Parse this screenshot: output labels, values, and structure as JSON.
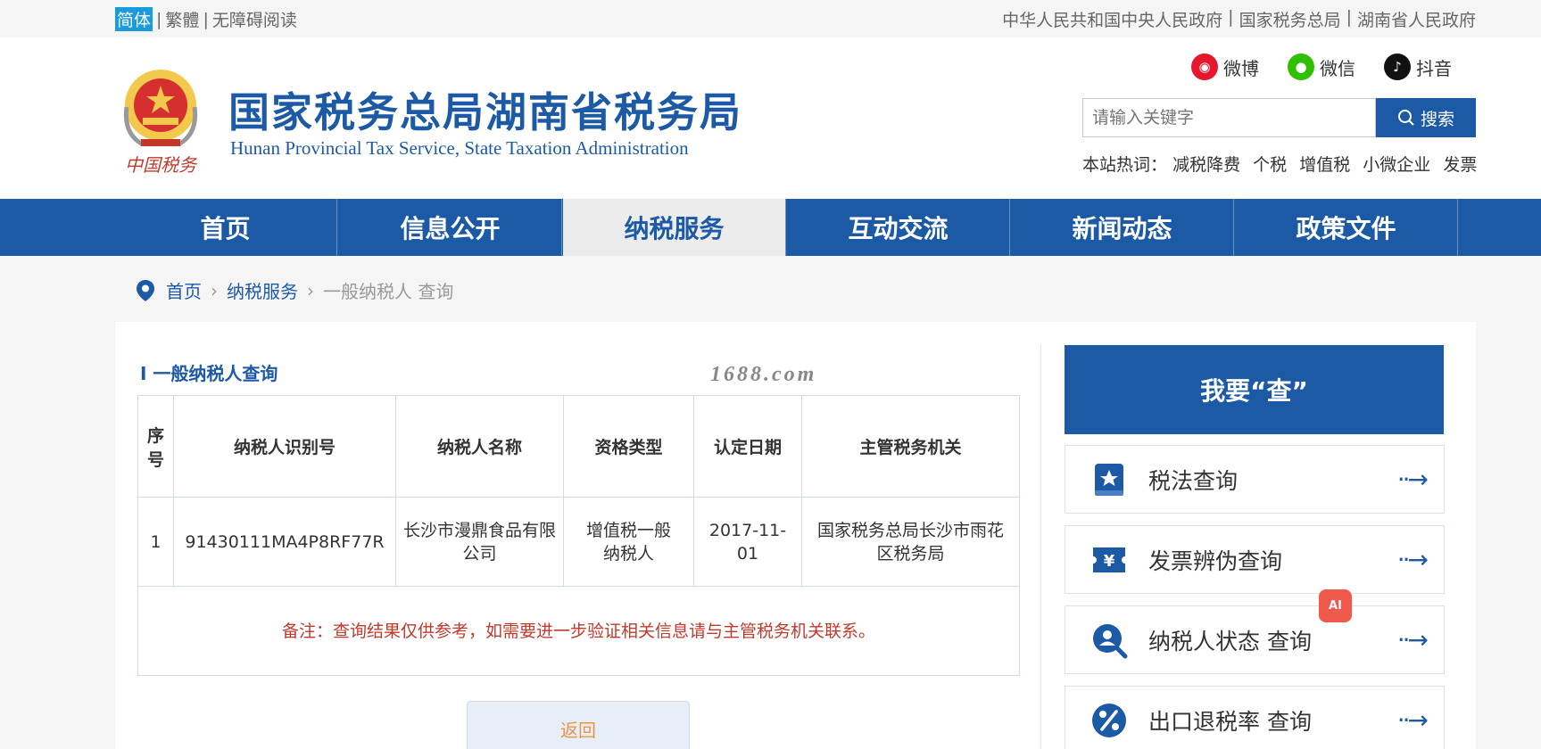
{
  "topbar": {
    "lang_simplified": "简体",
    "lang_traditional": "繁體",
    "accessible_reading": "无障碍阅读",
    "links": [
      "中华人民共和国中央人民政府",
      "国家税务总局",
      "湖南省人民政府"
    ]
  },
  "header": {
    "title": "国家税务总局湖南省税务局",
    "subtitle": "Hunan Provincial  Tax Service,  State Taxation Administration",
    "emblem_text": "中国税务",
    "social": {
      "weibo": "微博",
      "wechat": "微信",
      "douyin": "抖音"
    },
    "search_placeholder": "请输入关键字",
    "search_button": "搜索",
    "hotwords_label": "本站热词：",
    "hotwords": [
      "减税降费",
      "个税",
      "增值税",
      "小微企业",
      "发票"
    ]
  },
  "nav": {
    "items": [
      "首页",
      "信息公开",
      "纳税服务",
      "互动交流",
      "新闻动态",
      "政策文件"
    ],
    "active": "纳税服务"
  },
  "breadcrumb": {
    "home": "首页",
    "section": "纳税服务",
    "current": "一般纳税人 查询"
  },
  "main": {
    "section_title": "I 一般纳税人查询",
    "watermark": "1688.com",
    "table": {
      "headers": [
        "序号",
        "纳税人识别号",
        "纳税人名称",
        "资格类型",
        "认定日期",
        "主管税务机关"
      ],
      "rows": [
        [
          "1",
          "91430111MA4P8RF77R",
          "长沙市漫鼎食品有限公司",
          "增值税一般纳税人",
          "2017-11-01",
          "国家税务总局长沙市雨花区税务局"
        ]
      ],
      "note": "备注：查询结果仅供参考，如需要进一步验证相关信息请与主管税务机关联系。"
    },
    "back_button": "返回"
  },
  "sidebar": {
    "heading": "我要“查”",
    "cards": [
      {
        "label": "税法查询",
        "icon": "book-star-icon"
      },
      {
        "label": "发票辨伪查询",
        "icon": "invoice-ticket-icon"
      },
      {
        "label": "纳税人状态 查询",
        "icon": "person-search-icon"
      },
      {
        "label": "出口退税率 查询",
        "icon": "percent-icon"
      }
    ],
    "arrow": "··→",
    "ai_badge": "AI"
  },
  "colors": {
    "brand_blue": "#1c5aa6",
    "note_red": "#c0392b",
    "back_text": "#e8944a",
    "lang_active": "#1a9bdc"
  }
}
